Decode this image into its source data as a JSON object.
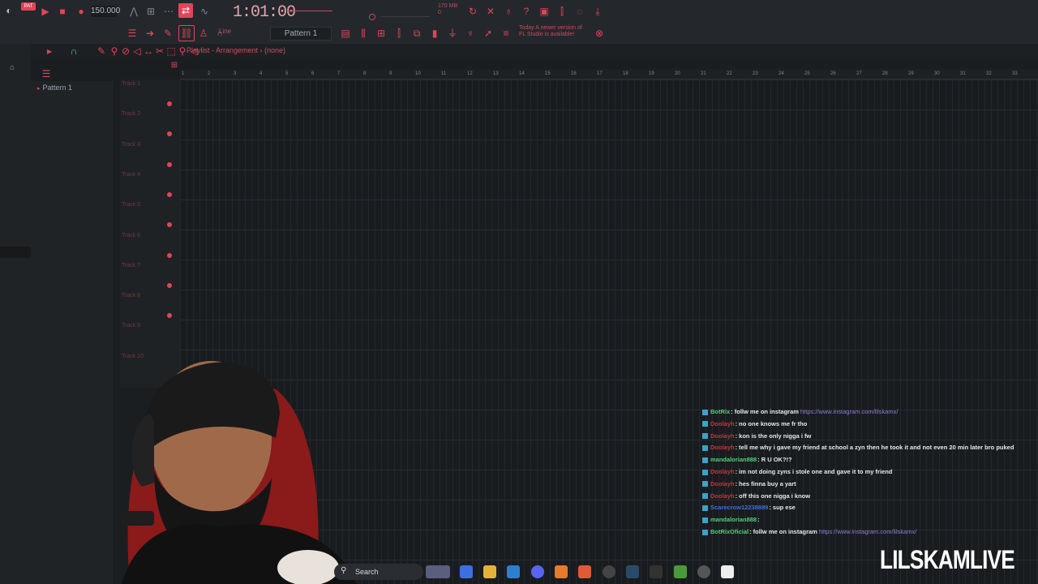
{
  "toolbar": {
    "bpm": "150.000",
    "time": "1:01:00",
    "pattern": "Pattern 1",
    "snap": "Line",
    "cpu": "170 MB",
    "cpu2": "0",
    "hint_line1": "Today  A newer version of",
    "hint_line2": "FL Studio is available!"
  },
  "playlist": {
    "title": "Playlist - Arrangement › (none)",
    "ruler": [
      "1",
      "2",
      "3",
      "4",
      "5",
      "6",
      "7",
      "8",
      "9",
      "10",
      "11",
      "12",
      "13",
      "14",
      "15",
      "16",
      "17",
      "18",
      "19",
      "20",
      "21",
      "22",
      "23",
      "24",
      "25",
      "26",
      "27",
      "28",
      "29",
      "30",
      "31",
      "32",
      "33"
    ],
    "tracks": [
      "Track 1",
      "Track 2",
      "Track 3",
      "Track 4",
      "Track 5",
      "Track 6",
      "Track 7",
      "Track 8",
      "Track 9",
      "Track 10"
    ]
  },
  "browser": {
    "pattern_item": "Pattern 1"
  },
  "chat": [
    {
      "user": "BotRix",
      "user_color": "#4fd07a",
      "text": ": follw me on instagram ",
      "link": "https://www.instagram.com/lilskamx/"
    },
    {
      "user": "Doolayh",
      "user_color": "#c8323e",
      "text": ": no one knows me fr tho",
      "link": ""
    },
    {
      "user": "Doolayh",
      "user_color": "#c8323e",
      "text": ": kon is the only nigga i fw",
      "link": ""
    },
    {
      "user": "Doolayh",
      "user_color": "#c8323e",
      "text": ": tell me why i gave my friend at school a zyn then he took it and not even 20 min later bro puked",
      "link": ""
    },
    {
      "user": "mandalorian888",
      "user_color": "#4fd07a",
      "text": ": R U OK?!?",
      "link": ""
    },
    {
      "user": "Doolayh",
      "user_color": "#c8323e",
      "text": ": im not doing zyns i stole one and gave it to my friend",
      "link": ""
    },
    {
      "user": "Doolayh",
      "user_color": "#c8323e",
      "text": ": hes finna buy a yart",
      "link": ""
    },
    {
      "user": "Doolayh",
      "user_color": "#c8323e",
      "text": ": off this one nigga i know",
      "link": ""
    },
    {
      "user": "Scarecrow12238889",
      "user_color": "#3b6fe0",
      "text": ": sup ese",
      "link": ""
    },
    {
      "user": "mandalorian888",
      "user_color": "#4fd07a",
      "text": ": ",
      "link": ""
    },
    {
      "user": "BotRixOficial",
      "user_color": "#4fd07a",
      "text": ": follw me on instagram ",
      "link": "https://www.instagram.com/lilskamx/"
    }
  ],
  "taskbar": {
    "search": "Search"
  },
  "watermark": "LILSKAMLIVE",
  "colors": {
    "accent": "#e0455a",
    "panel": "#24282c",
    "grid": "#191c1f"
  }
}
